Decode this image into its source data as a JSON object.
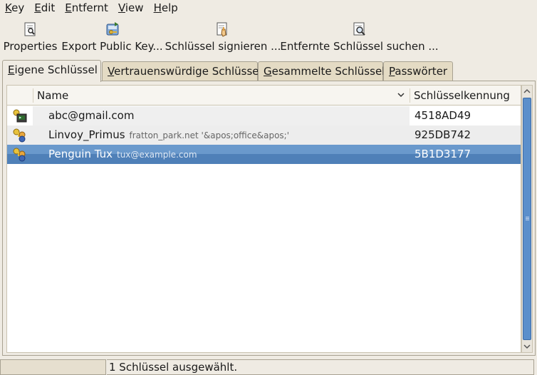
{
  "menubar": {
    "items": [
      {
        "mnemonic": "K",
        "rest": "ey"
      },
      {
        "mnemonic": "E",
        "rest": "dit"
      },
      {
        "mnemonic": "E",
        "rest": "ntfernt"
      },
      {
        "mnemonic": "V",
        "rest": "iew"
      },
      {
        "mnemonic": "H",
        "rest": "elp"
      }
    ]
  },
  "toolbar": {
    "properties_label": "Properties",
    "export_label": "Export Public Key...",
    "sign_label": "Schlüssel signieren ...",
    "search_label": "Entfernte Schlüssel suchen ..."
  },
  "tabs": [
    {
      "mnemonic": "E",
      "rest": "igene Schlüssel",
      "active": true
    },
    {
      "mnemonic": "V",
      "rest": "ertrauenswürdige Schlüssel",
      "active": false
    },
    {
      "mnemonic": "G",
      "rest": "esammelte Schlüssel",
      "active": false
    },
    {
      "mnemonic": "P",
      "rest": "asswörter",
      "active": false
    }
  ],
  "list": {
    "col_name": "Name",
    "col_id": "Schlüsselkennung",
    "rows": [
      {
        "name": "abc@gmail.com",
        "sub": "",
        "id": "4518AD49",
        "icon": "key-terminal-icon"
      },
      {
        "name": "Linvoy_Primus",
        "sub": "fratton_park.net  '&apos;office&apos;'",
        "id": "925DB742",
        "icon": "key-pair-icon"
      },
      {
        "name": "Penguin Tux",
        "sub": "tux@example.com",
        "id": "5B1D3177",
        "icon": "key-pair-icon"
      }
    ],
    "selected_index": 2
  },
  "statusbar": {
    "text": "1 Schlüssel ausgewählt."
  },
  "colors": {
    "selection": "#4f80b8",
    "scroll_thumb": "#5b8fcb",
    "background": "#efebe3"
  }
}
